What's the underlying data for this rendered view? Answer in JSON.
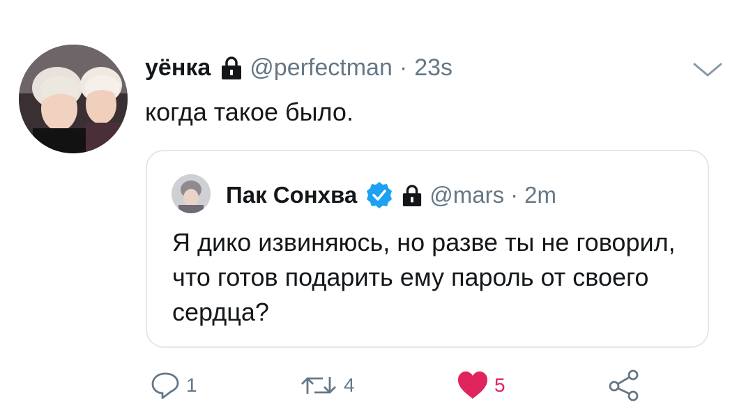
{
  "tweet": {
    "display_name": "уёнка",
    "handle": "@perfectman",
    "separator": "·",
    "time": "23s",
    "text": "когда такое было."
  },
  "quoted": {
    "display_name": "Пак Сонхва",
    "handle": "@mars",
    "separator": "·",
    "time": "2m",
    "text": "Я дико извиняюсь, но разве ты не говорил, что готов подарить ему пароль от своего сердца?"
  },
  "actions": {
    "reply_count": "1",
    "retweet_count": "4",
    "like_count": "5"
  },
  "icons": {
    "lock": "lock-icon",
    "verified": "verified-badge-icon",
    "chevron": "chevron-down-icon",
    "reply": "reply-icon",
    "retweet": "retweet-icon",
    "like": "heart-icon",
    "share": "share-icon"
  },
  "colors": {
    "text": "#14171a",
    "secondary": "#657786",
    "like": "#e0245e",
    "verified": "#1da1f2",
    "border": "#e1e8ed"
  }
}
